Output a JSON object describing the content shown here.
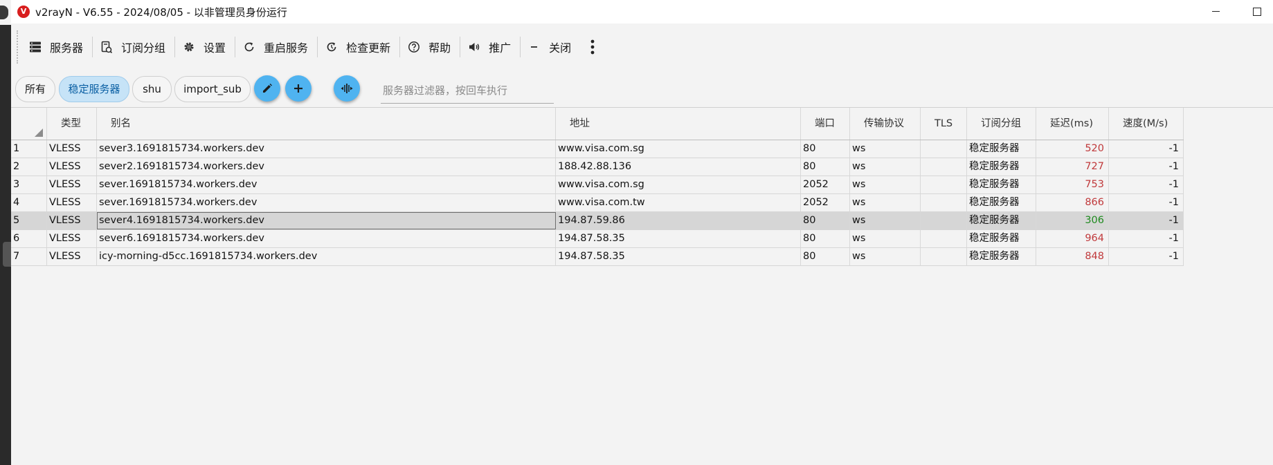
{
  "window": {
    "title": "v2rayN - V6.55 - 2024/08/05 - 以非管理员身份运行",
    "logo_letter": "V",
    "minimize_icon": "minimize-icon",
    "maximize_icon": "maximize-icon"
  },
  "toolbar": [
    {
      "label": "服务器",
      "icon": "server-icon"
    },
    {
      "label": "订阅分组",
      "icon": "subscription-icon"
    },
    {
      "label": "设置",
      "icon": "gear-icon"
    },
    {
      "label": "重启服务",
      "icon": "restart-icon"
    },
    {
      "label": "检查更新",
      "icon": "update-icon"
    },
    {
      "label": "帮助",
      "icon": "help-icon"
    },
    {
      "label": "推广",
      "icon": "promote-icon"
    },
    {
      "label": "关闭",
      "icon": "minus-icon"
    }
  ],
  "filter": {
    "chips": [
      {
        "label": "所有",
        "active": false
      },
      {
        "label": "稳定服务器",
        "active": true
      },
      {
        "label": "shu",
        "active": false
      },
      {
        "label": "import_sub",
        "active": false
      }
    ],
    "placeholder": "服务器过滤器，按回车执行"
  },
  "colors": {
    "accent": "#4fb3f0",
    "chip_active_bg": "#c6e3f7",
    "chip_active_text": "#0a5fa3",
    "delay_bad": "#c0393b",
    "delay_good": "#1e8a1e",
    "logo_red": "#d81e1e"
  },
  "table": {
    "columns": [
      "类型",
      "别名",
      "地址",
      "端口",
      "传输协议",
      "TLS",
      "订阅分组",
      "延迟(ms)",
      "速度(M/s)"
    ],
    "rows": [
      {
        "index": "1",
        "type": "VLESS",
        "alias": "sever3.1691815734.workers.dev",
        "address": "www.visa.com.sg",
        "port": "80",
        "transport": "ws",
        "tls": "",
        "group": "稳定服务器",
        "delay": "520",
        "delay_status": "bad",
        "speed": "-1"
      },
      {
        "index": "2",
        "type": "VLESS",
        "alias": "sever2.1691815734.workers.dev",
        "address": "188.42.88.136",
        "port": "80",
        "transport": "ws",
        "tls": "",
        "group": "稳定服务器",
        "delay": "727",
        "delay_status": "bad",
        "speed": "-1"
      },
      {
        "index": "3",
        "type": "VLESS",
        "alias": "sever.1691815734.workers.dev",
        "address": "www.visa.com.sg",
        "port": "2052",
        "transport": "ws",
        "tls": "",
        "group": "稳定服务器",
        "delay": "753",
        "delay_status": "bad",
        "speed": "-1"
      },
      {
        "index": "4",
        "type": "VLESS",
        "alias": "sever.1691815734.workers.dev",
        "address": "www.visa.com.tw",
        "port": "2052",
        "transport": "ws",
        "tls": "",
        "group": "稳定服务器",
        "delay": "866",
        "delay_status": "bad",
        "speed": "-1"
      },
      {
        "index": "5",
        "type": "VLESS",
        "alias": "sever4.1691815734.workers.dev",
        "address": "194.87.59.86",
        "port": "80",
        "transport": "ws",
        "tls": "",
        "group": "稳定服务器",
        "delay": "306",
        "delay_status": "good",
        "speed": "-1",
        "selected": true
      },
      {
        "index": "6",
        "type": "VLESS",
        "alias": "sever6.1691815734.workers.dev",
        "address": "194.87.58.35",
        "port": "80",
        "transport": "ws",
        "tls": "",
        "group": "稳定服务器",
        "delay": "964",
        "delay_status": "bad",
        "speed": "-1"
      },
      {
        "index": "7",
        "type": "VLESS",
        "alias": "icy-morning-d5cc.1691815734.workers.dev",
        "address": "194.87.58.35",
        "port": "80",
        "transport": "ws",
        "tls": "",
        "group": "稳定服务器",
        "delay": "848",
        "delay_status": "bad",
        "speed": "-1"
      }
    ]
  }
}
